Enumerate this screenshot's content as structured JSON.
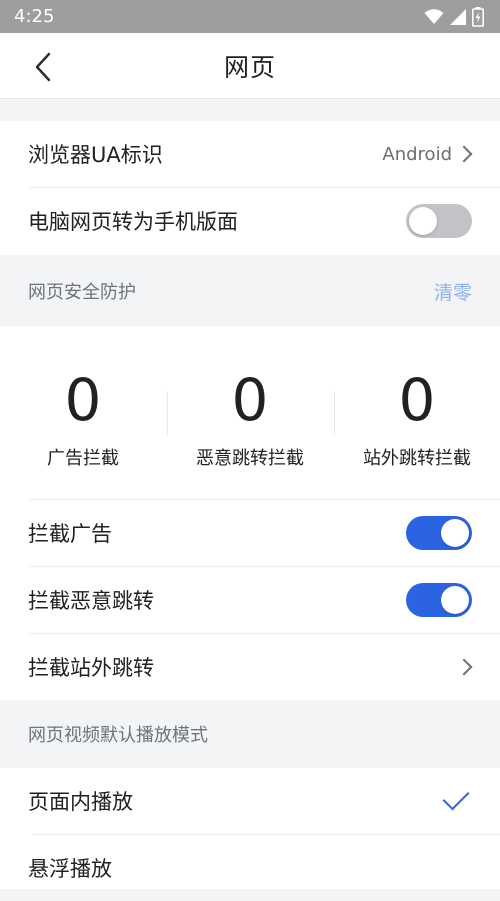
{
  "status_bar": {
    "time": "4:25",
    "icons": [
      "wifi-icon",
      "signal-icon",
      "battery-icon"
    ]
  },
  "app_bar": {
    "title": "网页",
    "back_icon": "chevron-left-icon"
  },
  "browser_section": {
    "ua_label": "浏览器UA标识",
    "ua_value": "Android",
    "desktop_mobile_label": "电脑网页转为手机版面",
    "desktop_mobile_enabled": false
  },
  "security_section": {
    "title": "网页安全防护",
    "clear_label": "清零",
    "stats": [
      {
        "value": "0",
        "label": "广告拦截"
      },
      {
        "value": "0",
        "label": "恶意跳转拦截"
      },
      {
        "value": "0",
        "label": "站外跳转拦截"
      }
    ],
    "block_ads_label": "拦截广告",
    "block_ads_enabled": true,
    "block_malicious_label": "拦截恶意跳转",
    "block_malicious_enabled": true,
    "block_external_label": "拦截站外跳转"
  },
  "video_section": {
    "title": "网页视频默认播放模式",
    "options": [
      {
        "label": "页面内播放",
        "selected": true
      },
      {
        "label": "悬浮播放",
        "selected": false
      }
    ]
  },
  "colors": {
    "accent": "#2c63e3",
    "toggle_off": "#c1c3c6",
    "clear_link": "#8fb0ee"
  }
}
